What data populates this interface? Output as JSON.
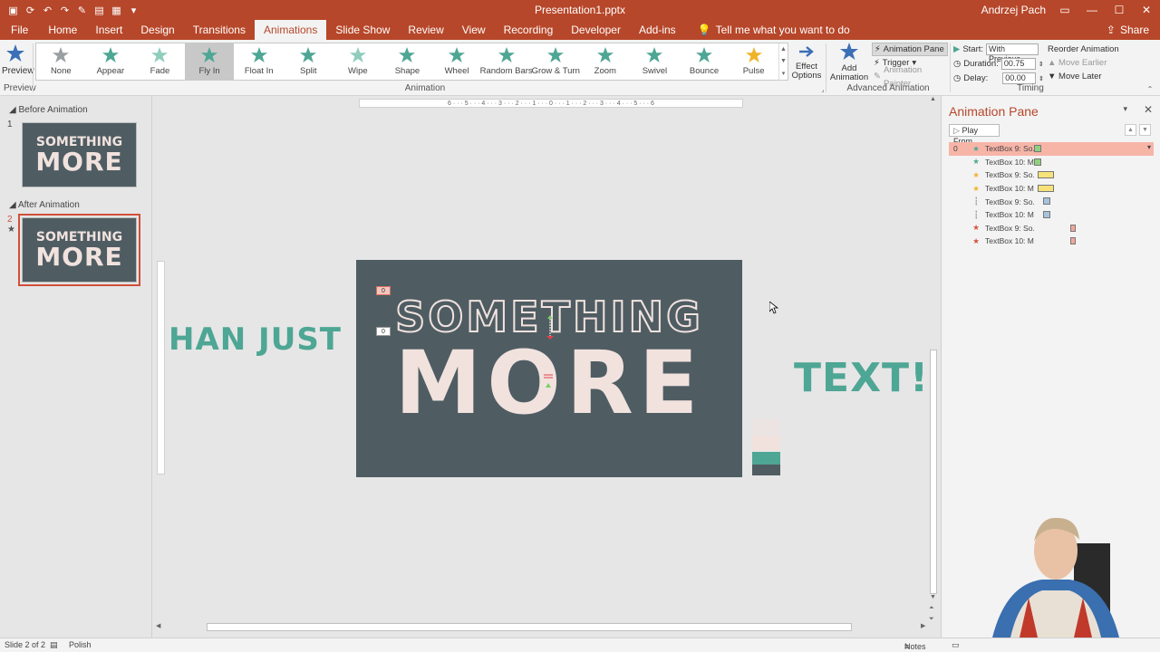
{
  "window": {
    "title": "Presentation1.pptx",
    "user": "Andrzej Pach",
    "minimize_icon": "minimize-icon",
    "restore_icon": "restore-icon",
    "close_icon": "close-icon"
  },
  "tabs": [
    {
      "label": "File"
    },
    {
      "label": "Home"
    },
    {
      "label": "Insert"
    },
    {
      "label": "Design"
    },
    {
      "label": "Transitions"
    },
    {
      "label": "Animations",
      "active": true
    },
    {
      "label": "Slide Show"
    },
    {
      "label": "Review"
    },
    {
      "label": "View"
    },
    {
      "label": "Recording"
    },
    {
      "label": "Developer"
    },
    {
      "label": "Add-ins"
    }
  ],
  "tell_me": "Tell me what you want to do",
  "share": "Share",
  "ribbon": {
    "preview": {
      "label": "Preview",
      "group_label": "Preview"
    },
    "animation_group_label": "Animation",
    "animations": [
      {
        "label": "None",
        "color": "#9aa0a2"
      },
      {
        "label": "Appear",
        "color": "#4ea694"
      },
      {
        "label": "Fade",
        "color": "#8fcdbd"
      },
      {
        "label": "Fly In",
        "color": "#4ea694",
        "selected": true
      },
      {
        "label": "Float In",
        "color": "#4ea694"
      },
      {
        "label": "Split",
        "color": "#4ea694"
      },
      {
        "label": "Wipe",
        "color": "#8fcdbd"
      },
      {
        "label": "Shape",
        "color": "#4ea694"
      },
      {
        "label": "Wheel",
        "color": "#4ea694"
      },
      {
        "label": "Random Bars",
        "color": "#4ea694"
      },
      {
        "label": "Grow & Turn",
        "color": "#4ea694"
      },
      {
        "label": "Zoom",
        "color": "#4ea694"
      },
      {
        "label": "Swivel",
        "color": "#4ea694"
      },
      {
        "label": "Bounce",
        "color": "#4ea694"
      },
      {
        "label": "Pulse",
        "color": "#f0b429"
      }
    ],
    "effect_options": {
      "line1": "Effect",
      "line2": "Options"
    },
    "add_animation": {
      "line1": "Add",
      "line2": "Animation"
    },
    "advanced": {
      "animation_pane": "Animation Pane",
      "trigger": "Trigger",
      "animation_painter": "Animation Painter",
      "group_label": "Advanced Animation"
    },
    "timing": {
      "start_label": "Start:",
      "start_value": "With Previous",
      "duration_label": "Duration:",
      "duration_value": "00.75",
      "delay_label": "Delay:",
      "delay_value": "00.00",
      "reorder_label": "Reorder Animation",
      "move_earlier": "Move Earlier",
      "move_later": "Move Later",
      "group_label": "Timing"
    }
  },
  "thumbnails": {
    "sections": [
      {
        "label": "Before Animation",
        "slide_number": "1",
        "line1": "SOMETHING",
        "line2": "MORE"
      },
      {
        "label": "After Animation",
        "slide_number": "2",
        "line1": "SOMETHING",
        "line2": "MORE",
        "selected": true
      }
    ]
  },
  "ruler": {
    "ticks": "6 · · · 5 · · · 4 · · · 3 · · · 2 · · · 1 · · · 0 · · · 1 · · · 2 · · · 3 · · · 4 · · · 5 · · · 6"
  },
  "slide": {
    "line1": "SOMETHING",
    "line2": "MORE",
    "offslide_left": "HAN JUST",
    "offslide_right": "TEXT!",
    "tag_a": "0",
    "tag_b": "0",
    "bg_color": "#4f5d63",
    "text_color": "#f1e2de",
    "accent_color": "#4ea694"
  },
  "animation_pane": {
    "title": "Animation Pane",
    "play_from": "Play From",
    "items": [
      {
        "num": "0",
        "icon": "entrance-star-icon",
        "name": "TextBox 9: So...",
        "color": "#8fd17f",
        "selected": true
      },
      {
        "num": "",
        "icon": "entrance-star-icon",
        "name": "TextBox 10: M...",
        "color": "#8fd17f"
      },
      {
        "num": "",
        "icon": "emphasis-star-icon",
        "name": "TextBox 9: So...",
        "color": "#f7e27a"
      },
      {
        "num": "",
        "icon": "emphasis-star-icon",
        "name": "TextBox 10: M...",
        "color": "#f7e27a"
      },
      {
        "num": "",
        "icon": "motion-path-icon",
        "name": "TextBox 9: So...",
        "color": "#a7c3dc"
      },
      {
        "num": "",
        "icon": "motion-path-icon",
        "name": "TextBox 10: M...",
        "color": "#a7c3dc"
      },
      {
        "num": "",
        "icon": "exit-star-icon",
        "name": "TextBox 9: So...",
        "color": "#f3a59a"
      },
      {
        "num": "",
        "icon": "exit-star-icon",
        "name": "TextBox 10: M...",
        "color": "#f3a59a"
      }
    ]
  },
  "status": {
    "slide_info": "Slide 2 of 2",
    "language": "Polish",
    "notes": "Notes"
  }
}
